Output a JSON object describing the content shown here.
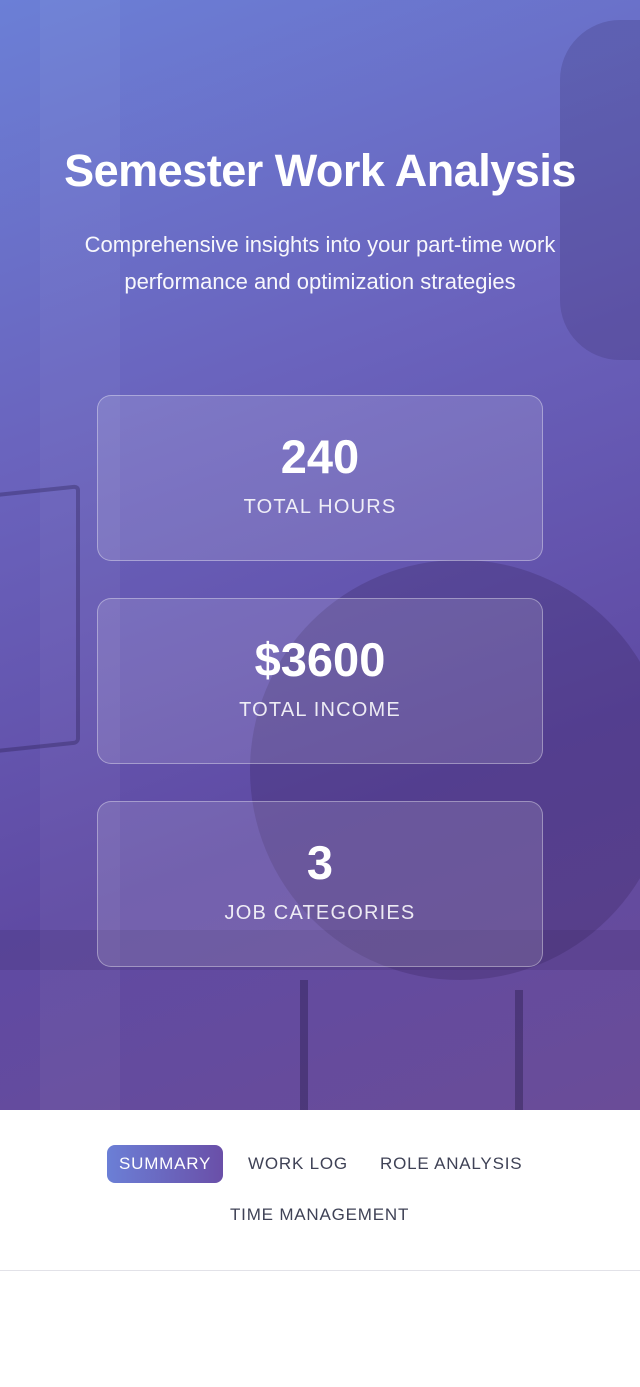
{
  "hero": {
    "title": "Semester Work Analysis",
    "subtitle": "Comprehensive insights into your part-time work performance and optimization strategies"
  },
  "stats": [
    {
      "value": "240",
      "label": "TOTAL HOURS"
    },
    {
      "value": "$3600",
      "label": "TOTAL INCOME"
    },
    {
      "value": "3",
      "label": "JOB CATEGORIES"
    }
  ],
  "tabs": [
    {
      "label": "SUMMARY",
      "active": true
    },
    {
      "label": "WORK LOG",
      "active": false
    },
    {
      "label": "ROLE ANALYSIS",
      "active": false
    },
    {
      "label": "TIME MANAGEMENT",
      "active": false
    }
  ],
  "colors": {
    "gradient_start": "#6b7fd6",
    "gradient_end": "#6a4c98",
    "tab_text": "#3f4256"
  }
}
